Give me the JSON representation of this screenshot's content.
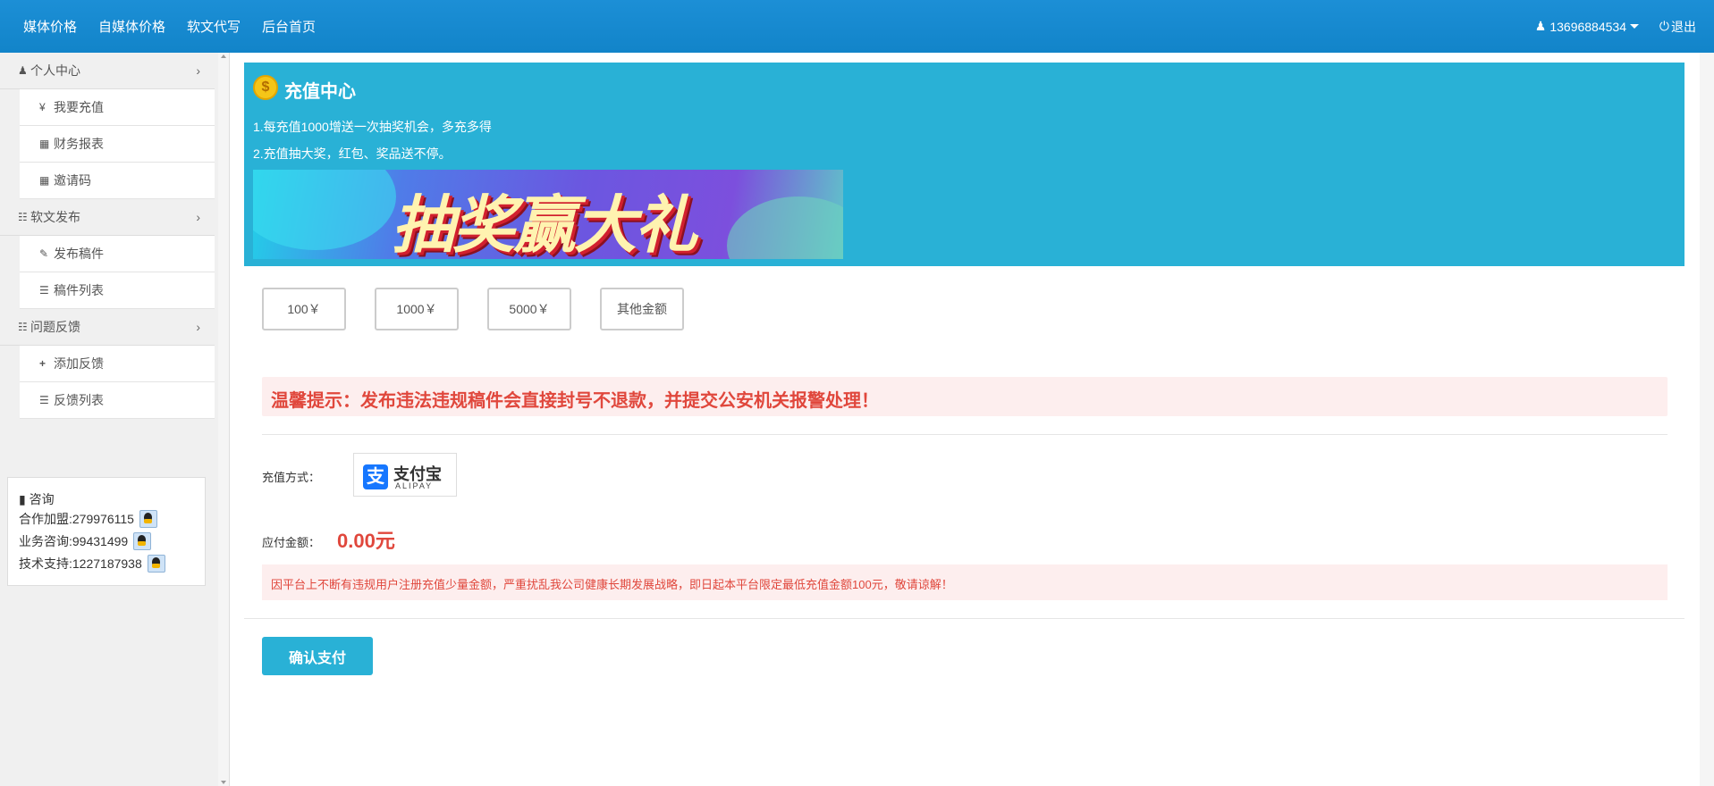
{
  "header": {
    "nav": [
      "媒体价格",
      "自媒体价格",
      "软文代写",
      "后台首页"
    ],
    "user": "13696884534",
    "logout": "退出"
  },
  "sidebar": {
    "groups": [
      {
        "label": "个人中心",
        "icon": "user-icon",
        "items": [
          {
            "label": "我要充值",
            "icon": "yen-icon"
          },
          {
            "label": "财务报表",
            "icon": "table-icon"
          },
          {
            "label": "邀请码",
            "icon": "table-icon"
          }
        ]
      },
      {
        "label": "软文发布",
        "icon": "book-icon",
        "items": [
          {
            "label": "发布稿件",
            "icon": "edit-icon"
          },
          {
            "label": "稿件列表",
            "icon": "list-icon"
          }
        ]
      },
      {
        "label": "问题反馈",
        "icon": "book-icon",
        "items": [
          {
            "label": "添加反馈",
            "icon": "plus-icon"
          },
          {
            "label": "反馈列表",
            "icon": "list-icon"
          }
        ]
      }
    ],
    "consult": {
      "title": "咨询",
      "rows": [
        {
          "label": "合作加盟:279976115"
        },
        {
          "label": "业务咨询:99431499"
        },
        {
          "label": "技术支持:1227187938"
        }
      ]
    }
  },
  "recharge": {
    "title": "充值中心",
    "lines": [
      "1.每充值1000增送一次抽奖机会，多充多得",
      "2.充值抽大奖，红包、奖品送不停。"
    ],
    "banner_text": "抽奖赢大礼",
    "amounts": [
      "100￥",
      "1000￥",
      "5000￥",
      "其他金额"
    ],
    "warning": "温馨提示：发布违法违规稿件会直接封号不退款，并提交公安机关报警处理！",
    "payment_label": "充值方式：",
    "alipay_cn": "支付宝",
    "alipay_en": "ALIPAY",
    "due_label": "应付金额：",
    "due_value": "0.00元",
    "notice": "因平台上不断有违规用户注册充值少量金额，严重扰乱我公司健康长期发展战略，即日起本平台限定最低充值金额100元，敬请谅解！",
    "confirm": "确认支付"
  },
  "colors": {
    "topbar": "#1284c9",
    "accent": "#29b1d6",
    "danger": "#e0473c"
  }
}
